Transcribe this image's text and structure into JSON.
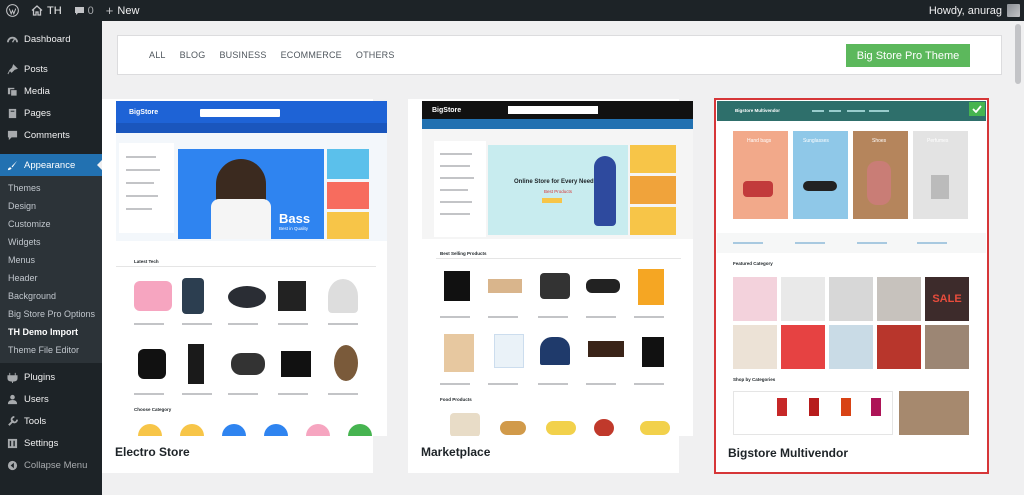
{
  "admin_bar": {
    "site_name": "TH",
    "comments_count": "0",
    "new_label": "New",
    "greeting": "Howdy, anurag"
  },
  "sidebar": {
    "items": [
      {
        "label": "Dashboard",
        "icon": "dashboard-icon"
      },
      {
        "label": "Posts",
        "icon": "pin-icon"
      },
      {
        "label": "Media",
        "icon": "media-icon"
      },
      {
        "label": "Pages",
        "icon": "pages-icon"
      },
      {
        "label": "Comments",
        "icon": "comment-icon"
      },
      {
        "label": "Appearance",
        "icon": "brush-icon"
      },
      {
        "label": "Plugins",
        "icon": "plugin-icon"
      },
      {
        "label": "Users",
        "icon": "user-icon"
      },
      {
        "label": "Tools",
        "icon": "wrench-icon"
      },
      {
        "label": "Settings",
        "icon": "settings-icon"
      },
      {
        "label": "Collapse Menu",
        "icon": "collapse-icon"
      }
    ],
    "appearance_submenu": [
      "Themes",
      "Design",
      "Customize",
      "Widgets",
      "Menus",
      "Header",
      "Background",
      "Big Store Pro Options",
      "TH Demo Import",
      "Theme File Editor"
    ]
  },
  "filters": [
    "ALL",
    "BLOG",
    "BUSINESS",
    "ECOMMERCE",
    "OTHERS"
  ],
  "pro_button": "Big Store Pro Theme",
  "cards": [
    {
      "name": "Electro Store"
    },
    {
      "name": "Marketplace"
    },
    {
      "name": "Bigstore Multivendor"
    }
  ],
  "thumbs": {
    "electro": {
      "logo": "BigStore",
      "hero_title": "Bass",
      "hero_sub": "Best in Quality",
      "section1": "Latest Tech",
      "section2": "Choose Category"
    },
    "market": {
      "logo": "BigStore",
      "hero_title": "Online Store for Every Need",
      "hero_sub": "Best Products",
      "section1": "Best Selling Products",
      "section2": "Food Products"
    },
    "multi": {
      "logo": "Bigstore Multivendor",
      "cats": [
        "Hand bags",
        "Sunglasses",
        "Shoes",
        "Perfumes"
      ],
      "section1": "Featured Category",
      "section2": "Shop by Categories",
      "sale": "SALE"
    }
  },
  "colors": {
    "admin_dark": "#1d2327",
    "active_blue": "#2271b1",
    "pro_green": "#5cb85c",
    "selected_red": "#d63638",
    "electro_blue": "#1e63d6",
    "multi_teal": "#2e6f6b"
  }
}
